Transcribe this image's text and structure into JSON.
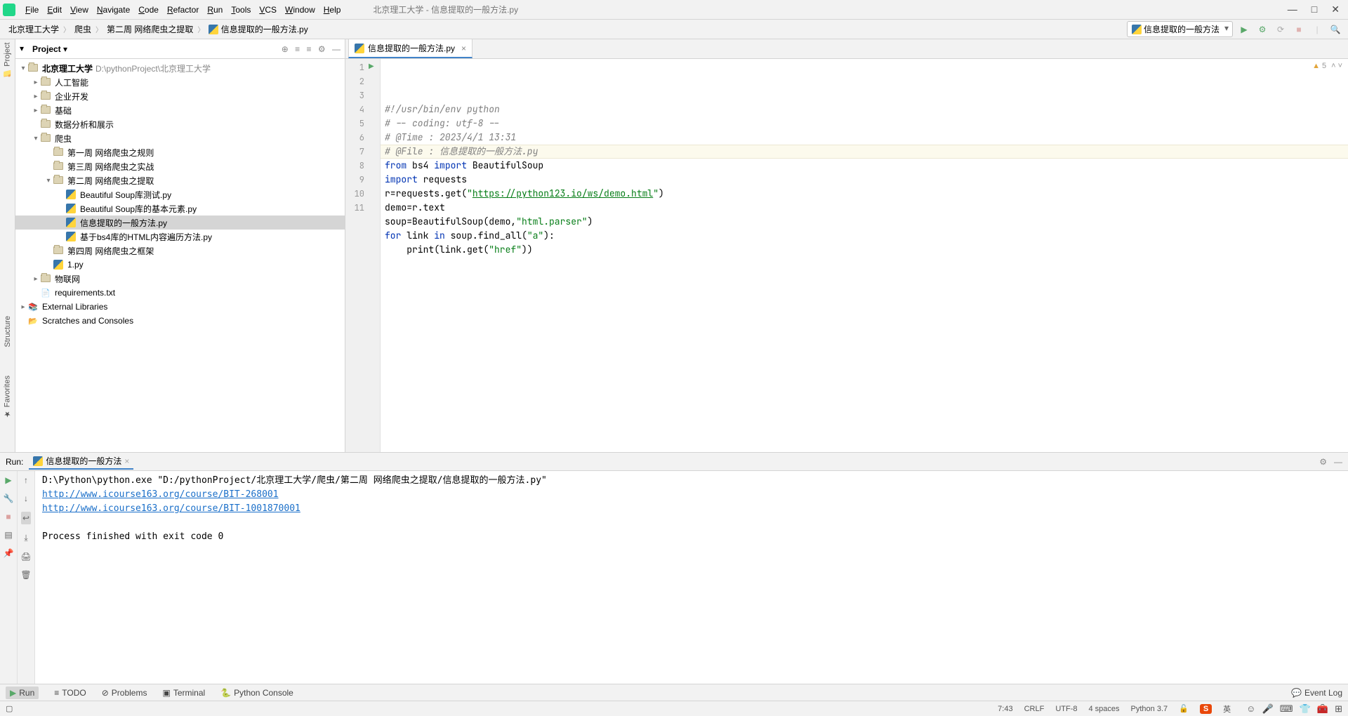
{
  "menu": {
    "items": [
      "File",
      "Edit",
      "View",
      "Navigate",
      "Code",
      "Refactor",
      "Run",
      "Tools",
      "VCS",
      "Window",
      "Help"
    ]
  },
  "window_title": "北京理工大学 - 信息提取的一般方法.py",
  "breadcrumbs": {
    "items": [
      "北京理工大学",
      "爬虫",
      "第二周 网络爬虫之提取",
      "信息提取的一般方法.py"
    ]
  },
  "run_config_selected": "信息提取的一般方法",
  "project_panel": {
    "title": "Project",
    "root_name": "北京理工大学",
    "root_path": "D:\\pythonProject\\北京理工大学",
    "tree": [
      {
        "depth": 1,
        "arrow": ">",
        "kind": "dir",
        "label": "人工智能"
      },
      {
        "depth": 1,
        "arrow": ">",
        "kind": "dir",
        "label": "企业开发"
      },
      {
        "depth": 1,
        "arrow": ">",
        "kind": "dir",
        "label": "基础"
      },
      {
        "depth": 1,
        "arrow": "",
        "kind": "dir",
        "label": "数据分析和展示"
      },
      {
        "depth": 1,
        "arrow": "v",
        "kind": "dir",
        "label": "爬虫"
      },
      {
        "depth": 2,
        "arrow": "",
        "kind": "dir",
        "label": "第一周 网络爬虫之规则"
      },
      {
        "depth": 2,
        "arrow": "",
        "kind": "dir",
        "label": "第三周 网络爬虫之实战"
      },
      {
        "depth": 2,
        "arrow": "v",
        "kind": "dir",
        "label": "第二周 网络爬虫之提取"
      },
      {
        "depth": 3,
        "arrow": "",
        "kind": "py",
        "label": "Beautiful Soup库测试.py"
      },
      {
        "depth": 3,
        "arrow": "",
        "kind": "py",
        "label": "Beautiful  Soup库的基本元素.py"
      },
      {
        "depth": 3,
        "arrow": "",
        "kind": "py",
        "label": "信息提取的一般方法.py",
        "selected": true
      },
      {
        "depth": 3,
        "arrow": "",
        "kind": "py",
        "label": "基于bs4库的HTML内容遍历方法.py"
      },
      {
        "depth": 2,
        "arrow": "",
        "kind": "dir",
        "label": "第四周 网络爬虫之框架"
      },
      {
        "depth": 2,
        "arrow": "",
        "kind": "py",
        "label": "1.py"
      },
      {
        "depth": 1,
        "arrow": ">",
        "kind": "dir",
        "label": "物联网"
      },
      {
        "depth": 1,
        "arrow": "",
        "kind": "txt",
        "label": "requirements.txt"
      }
    ],
    "extra": [
      {
        "arrow": ">",
        "kind": "lib",
        "label": "External Libraries"
      },
      {
        "arrow": "",
        "kind": "scratch",
        "label": "Scratches and Consoles"
      }
    ]
  },
  "editor": {
    "tab_name": "信息提取的一般方法.py",
    "warn_count": "5",
    "lines": [
      {
        "n": 1,
        "raw": "#!/usr/bin/env python",
        "cls": "comment"
      },
      {
        "n": 2,
        "raw": "# -- coding: utf-8 --",
        "cls": "comment"
      },
      {
        "n": 3,
        "raw": "# @Time : 2023/4/1 13:31",
        "cls": "comment"
      },
      {
        "n": 4,
        "raw": "# @File : 信息提取的一般方法.py",
        "cls": "comment"
      },
      {
        "n": 5,
        "segments": [
          {
            "t": "from ",
            "c": "kw"
          },
          {
            "t": "bs4 ",
            "c": ""
          },
          {
            "t": "import ",
            "c": "kw"
          },
          {
            "t": "BeautifulSoup",
            "c": ""
          }
        ]
      },
      {
        "n": 6,
        "segments": [
          {
            "t": "import ",
            "c": "kw"
          },
          {
            "t": "requests",
            "c": ""
          }
        ]
      },
      {
        "n": 7,
        "segments": [
          {
            "t": "r=requests.get(",
            "c": ""
          },
          {
            "t": "\"",
            "c": "str"
          },
          {
            "t": "https://python123.io/ws/demo.html",
            "c": "url"
          },
          {
            "t": "\"",
            "c": "str"
          },
          {
            "t": ")",
            "c": ""
          }
        ],
        "hl": true
      },
      {
        "n": 8,
        "segments": [
          {
            "t": "demo=r.text",
            "c": ""
          }
        ]
      },
      {
        "n": 9,
        "segments": [
          {
            "t": "soup=BeautifulSoup(demo,",
            "c": ""
          },
          {
            "t": "\"html.parser\"",
            "c": "str"
          },
          {
            "t": ")",
            "c": ""
          }
        ]
      },
      {
        "n": 10,
        "segments": [
          {
            "t": "for ",
            "c": "kw"
          },
          {
            "t": "link ",
            "c": ""
          },
          {
            "t": "in ",
            "c": "kw"
          },
          {
            "t": "soup.find_all(",
            "c": ""
          },
          {
            "t": "\"a\"",
            "c": "str"
          },
          {
            "t": "):",
            "c": ""
          }
        ]
      },
      {
        "n": 11,
        "segments": [
          {
            "t": "    print(link.get(",
            "c": ""
          },
          {
            "t": "\"href\"",
            "c": "str"
          },
          {
            "t": "))",
            "c": ""
          }
        ]
      }
    ]
  },
  "run": {
    "label": "Run:",
    "tab_name": "信息提取的一般方法",
    "line_cmd": "D:\\Python\\python.exe \"D:/pythonProject/北京理工大学/爬虫/第二周 网络爬虫之提取/信息提取的一般方法.py\"",
    "link1": "http://www.icourse163.org/course/BIT-268001",
    "link2": "http://www.icourse163.org/course/BIT-1001870001",
    "exit": "Process finished with exit code 0"
  },
  "bottom_tabs": {
    "run": "Run",
    "todo": "TODO",
    "problems": "Problems",
    "terminal": "Terminal",
    "python_console": "Python Console",
    "event_log": "Event Log"
  },
  "status": {
    "cursor": "7:43",
    "crlf": "CRLF",
    "encoding": "UTF-8",
    "spaces": "4 spaces",
    "python": "Python 3.7",
    "lock": "🔓",
    "ime": "S",
    "ime2": "英"
  },
  "left_tabs": {
    "project": "Project",
    "structure": "Structure",
    "favorites": "Favorites"
  }
}
